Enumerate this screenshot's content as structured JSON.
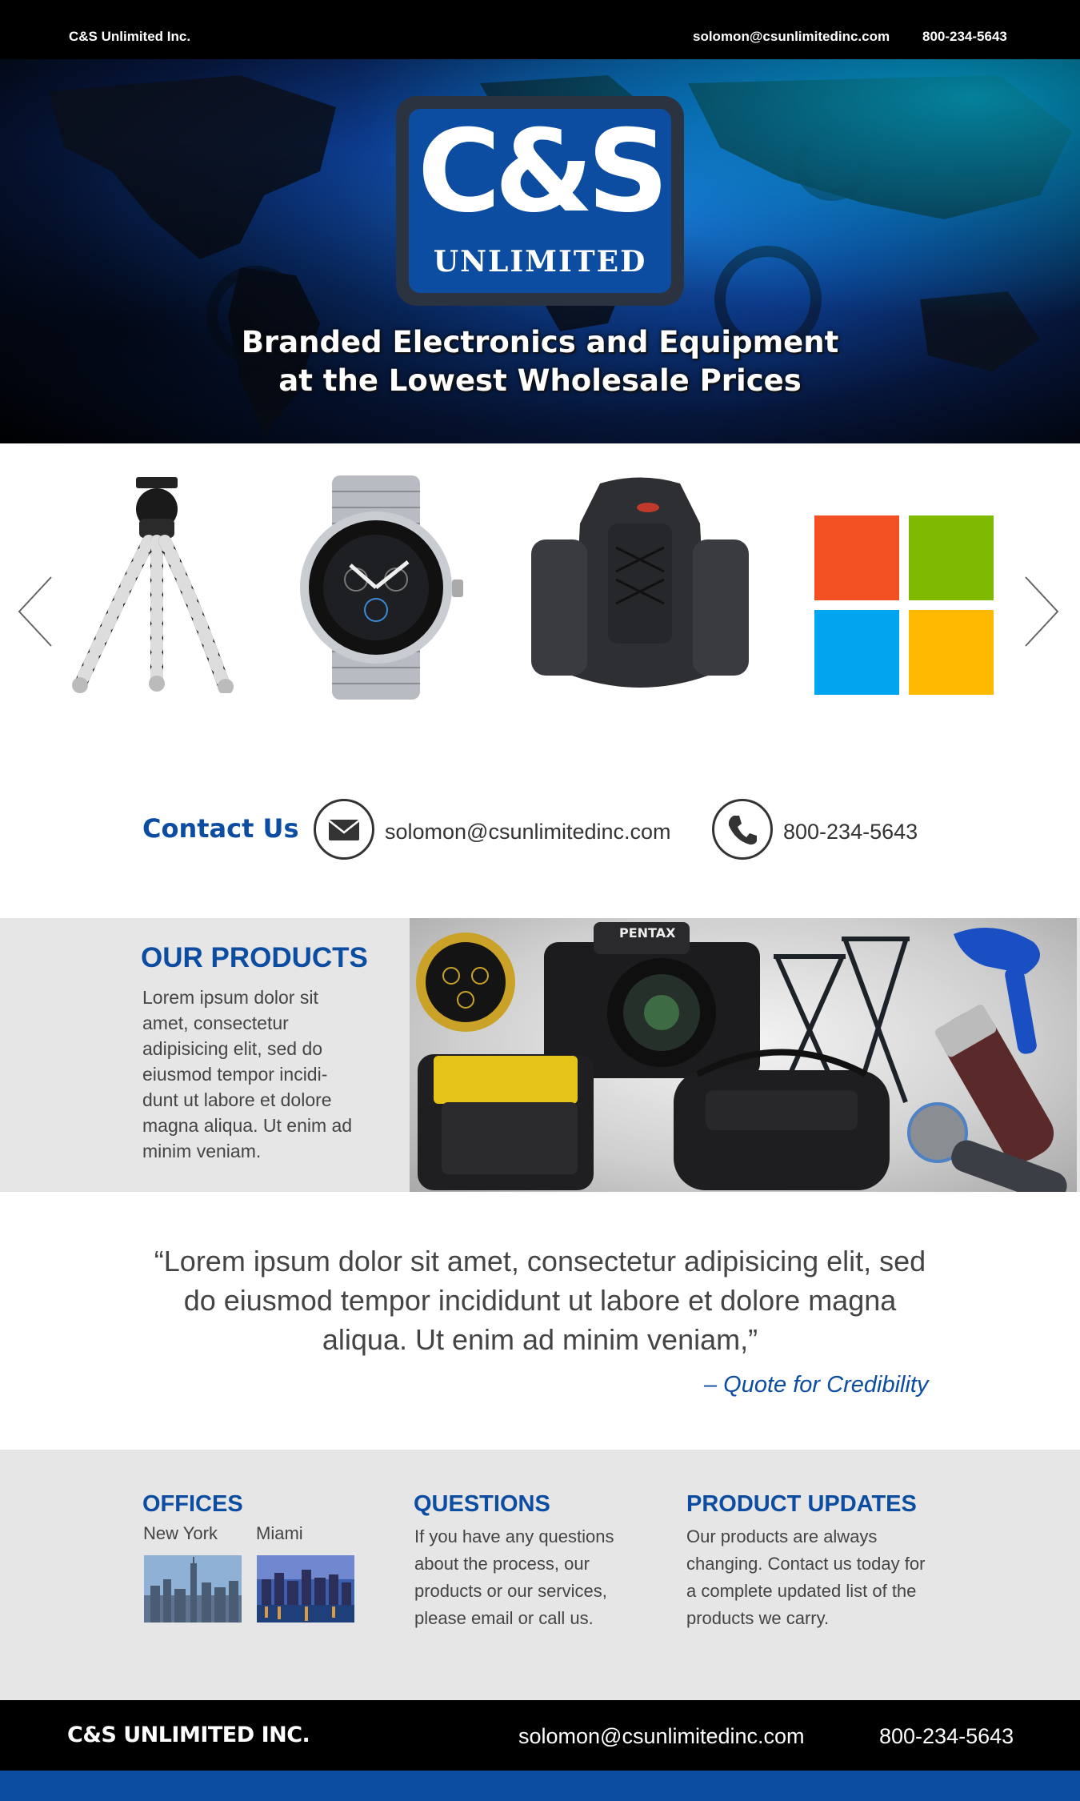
{
  "topbar": {
    "company": "C&S Unlimited Inc.",
    "email": "solomon@csunlimitedinc.com",
    "phone": "800-234-5643"
  },
  "hero": {
    "logo_main": "C&S",
    "logo_sub": "UNLIMITED",
    "tagline_line1": "Branded Electronics and Equipment",
    "tagline_line2": "at the Lowest Wholesale Prices"
  },
  "carousel": {
    "items": [
      {
        "icon": "tripod-icon"
      },
      {
        "icon": "watch-icon"
      },
      {
        "icon": "backpack-icon"
      },
      {
        "icon": "microsoft-logo-icon"
      }
    ],
    "prev_icon": "chevron-left-icon",
    "next_icon": "chevron-right-icon"
  },
  "contact": {
    "label": "Contact Us",
    "email": "solomon@csunlimitedinc.com",
    "phone": "800-234-5643",
    "email_icon": "envelope-icon",
    "phone_icon": "phone-icon"
  },
  "products": {
    "heading": "OUR PRODUCTS",
    "body": "Lorem ipsum dolor sit amet, consectetur adipisicing elit, sed do eiusmod tempor incidi-dunt ut labore et dolore magna aliqua. Ut enim ad minim veniam."
  },
  "quote": {
    "text": "“Lorem ipsum dolor sit amet, consectetur adipisicing elit, sed do eiusmod tempor incididunt ut labore et dolore magna aliqua. Ut enim ad minim veniam,”",
    "attribution": "– Quote for Credibility"
  },
  "info": {
    "offices": {
      "heading": "OFFICES",
      "city1": "New York",
      "city2": "Miami"
    },
    "questions": {
      "heading": "QUESTIONS",
      "body": "If you have any questions about the process, our products or our services, please email or call us."
    },
    "updates": {
      "heading": "PRODUCT UPDATES",
      "body": "Our products are always changing. Contact us today for a complete updated list of the products we carry."
    }
  },
  "footer": {
    "company": "C&S UNLIMITED INC.",
    "email": "solomon@csunlimitedinc.com",
    "phone": "800-234-5643"
  },
  "colors": {
    "brand_blue": "#0c4da2",
    "dark": "#000000",
    "light_gray": "#e6e6e6"
  }
}
